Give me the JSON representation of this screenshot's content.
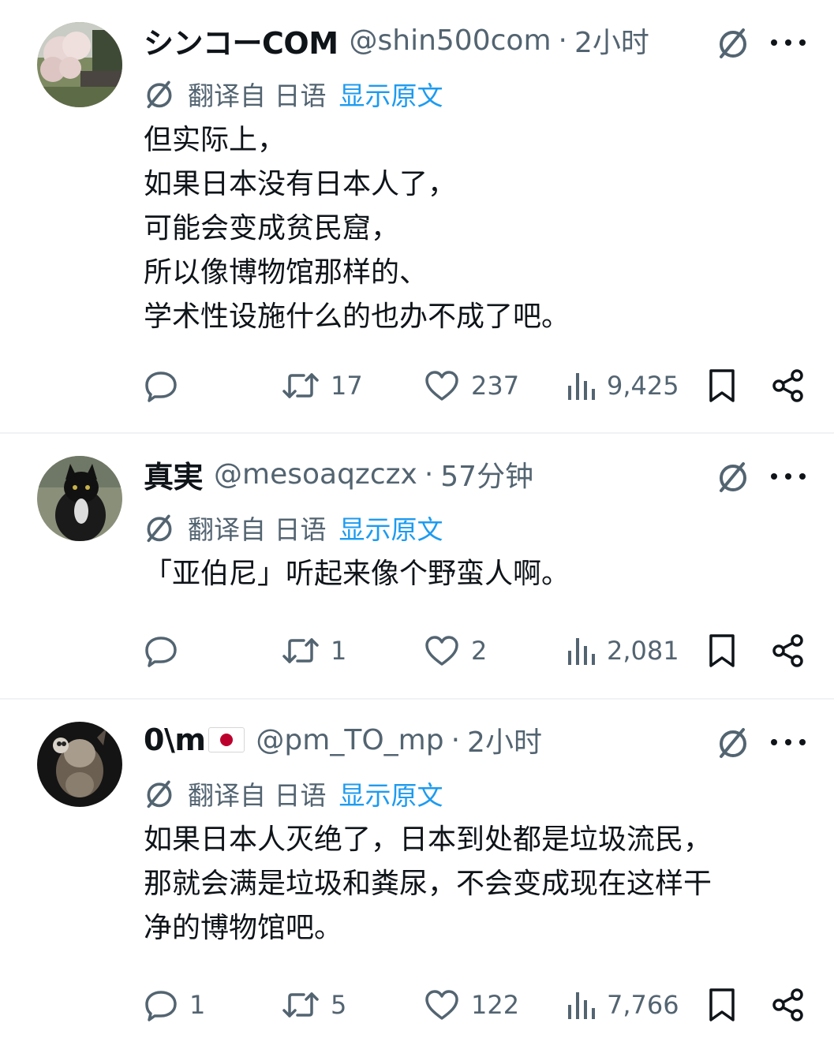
{
  "colors": {
    "text": "#0f1419",
    "muted": "#536471",
    "link": "#1d9bf0",
    "divider": "#eff3f4"
  },
  "icons": [
    "grok-icon",
    "more-icon",
    "translate-icon",
    "reply-icon",
    "retweet-icon",
    "like-icon",
    "views-icon",
    "bookmark-icon",
    "share-icon"
  ],
  "tweets": [
    {
      "name": "シンコーCOM",
      "handle": "@shin500com",
      "sep": "·",
      "time": "2小时",
      "translated_from": "翻译自 日语",
      "show_original": "显示原文",
      "text": "但实际上，\n如果日本没有日本人了，\n可能会变成贫民窟，\n所以像博物馆那样的、\n学术性设施什么的也办不成了吧。",
      "replies": "",
      "retweets": "17",
      "likes": "237",
      "views": "9,425"
    },
    {
      "name": "真実",
      "handle": "@mesoaqzczx",
      "sep": "·",
      "time": "57分钟",
      "translated_from": "翻译自 日语",
      "show_original": "显示原文",
      "text": "「亚伯尼」听起来像个野蛮人啊。",
      "replies": "",
      "retweets": "1",
      "likes": "2",
      "views": "2,081"
    },
    {
      "name": "0\\m",
      "handle": "@pm_TO_mp",
      "sep": "·",
      "time": "2小时",
      "translated_from": "翻译自 日语",
      "show_original": "显示原文",
      "text": "如果日本人灭绝了，日本到处都是垃圾流民，\n那就会满是垃圾和粪尿，不会变成现在这样干\n净的博物馆吧。",
      "replies": "1",
      "retweets": "5",
      "likes": "122",
      "views": "7,766"
    }
  ]
}
